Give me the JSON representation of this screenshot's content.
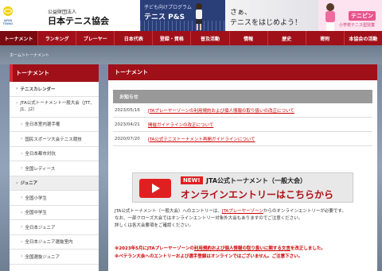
{
  "header": {
    "org_type": "公益財団法人",
    "org_name": "日本テニス協会",
    "banner1_small": "子ども向けプログラム",
    "banner1_big": "テニス P&S",
    "banner2_line1": "さぁ、",
    "banner2_line2": "テニスをはじめよう！",
    "banner3_title": "テニピン",
    "banner3_sub": "小学校テニス型授業"
  },
  "nav": {
    "items": [
      "トーナメント",
      "ランキング",
      "プレーヤー",
      "日本代表",
      "登録・資格",
      "普及活動",
      "情報",
      "歴史",
      "寄附",
      "本協会の活動"
    ]
  },
  "breadcrumb": "ホーム＞トーナメント",
  "sidebar": {
    "title": "トーナメント",
    "items": [
      {
        "label": "テニスカレンダー",
        "type": "bold"
      },
      {
        "label": "JTA公式トーナメント一般大会（JTT、J1、J2）",
        "type": "two"
      },
      {
        "label": "全日本室内選手権",
        "type": "sub"
      },
      {
        "label": "国民スポーツ大会テニス競技",
        "type": "sub"
      },
      {
        "label": "全日本都市対抗",
        "type": "sub"
      },
      {
        "label": "全国レディース",
        "type": "sub"
      },
      {
        "label": "ジュニア",
        "type": "section"
      },
      {
        "label": "全国小学生",
        "type": "sub"
      },
      {
        "label": "全国中学生",
        "type": "sub"
      },
      {
        "label": "全日本ジュニア",
        "type": "sub"
      },
      {
        "label": "全日本ジュニア選抜室内",
        "type": "sub"
      },
      {
        "label": "全国選抜ジュニア",
        "type": "sub"
      }
    ]
  },
  "content": {
    "title": "トーナメント",
    "notice_title": "お知らせ",
    "notices": [
      {
        "date": "2023/05/16",
        "text": "JTAプレーヤーゾーンの利用規約および個人情報の取り扱いの改正について"
      },
      {
        "date": "2023/04/21",
        "text": "開催ガイドラインの改正について"
      },
      {
        "date": "2020/07/20",
        "text": "JTA公式テニストーナメント再開ガイドラインについて"
      }
    ],
    "banner_new": "NEW!",
    "banner_line1": "JTA公式トーナメント（一般大会）",
    "banner_line2": "オンラインエントリーはこちらから",
    "para1_pre": "JTA公式トーナメント（一般大会）へのエントリーは、",
    "para1_link": "JTAプレーヤーゾーン",
    "para1_post": "からのオンラインエントリーが必要です。",
    "para2": "なお、一部クローズ大会ではオンラインエントリー対象外大会もありますのでご注意ください。",
    "para3": "詳しくは各大会要項をご確認ください。",
    "note1_pre": "※2023年5月にJTAプレーヤーゾーンの",
    "note1_link": "利用規約および個人情報の取り扱いに関する文言",
    "note1_post": "を改正しました。",
    "note2": "※ベテラン大会へのエントリーおよび選手登録はオンラインではございません。ご注意下さい。"
  },
  "colors": {
    "brand_red": "#a01018",
    "link_red": "#cc0000"
  }
}
